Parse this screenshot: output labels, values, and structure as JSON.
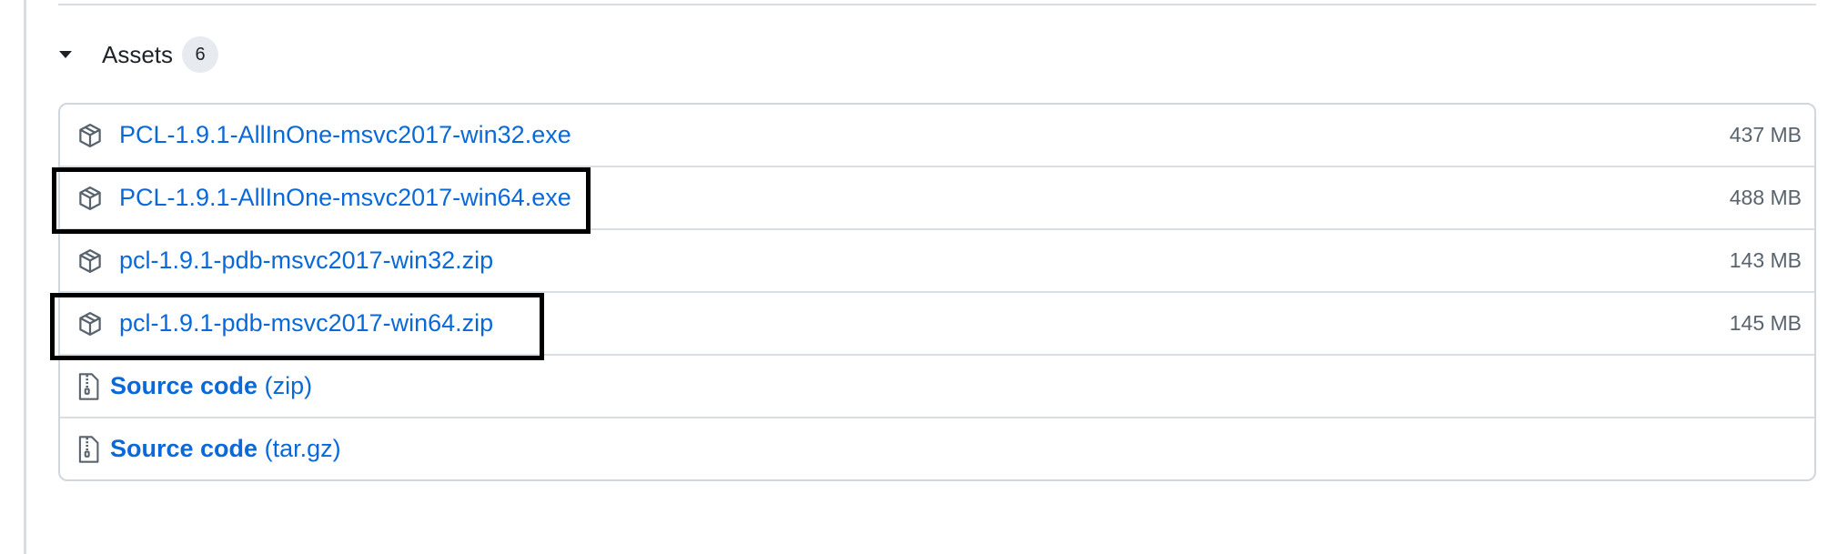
{
  "assets": {
    "title": "Assets",
    "count": "6",
    "toggle_icon": "triangle-down-icon",
    "files": [
      {
        "name": "PCL-1.9.1-AllInOne-msvc2017-win32.exe",
        "size": "437 MB",
        "icon": "package-icon",
        "highlighted": false
      },
      {
        "name": "PCL-1.9.1-AllInOne-msvc2017-win64.exe",
        "size": "488 MB",
        "icon": "package-icon",
        "highlighted": true
      },
      {
        "name": "pcl-1.9.1-pdb-msvc2017-win32.zip",
        "size": "143 MB",
        "icon": "package-icon",
        "highlighted": false
      },
      {
        "name": "pcl-1.9.1-pdb-msvc2017-win64.zip",
        "size": "145 MB",
        "icon": "package-icon",
        "highlighted": true
      }
    ],
    "source": [
      {
        "label": "Source code",
        "format": "(zip)",
        "icon": "file-zip-icon"
      },
      {
        "label": "Source code",
        "format": "(tar.gz)",
        "icon": "file-zip-icon"
      }
    ]
  },
  "colors": {
    "link": "#0969da",
    "text": "#1f2328",
    "muted": "#59636e",
    "border": "#d0d7de",
    "counter_bg": "#e7eaee",
    "highlight": "#000000"
  }
}
